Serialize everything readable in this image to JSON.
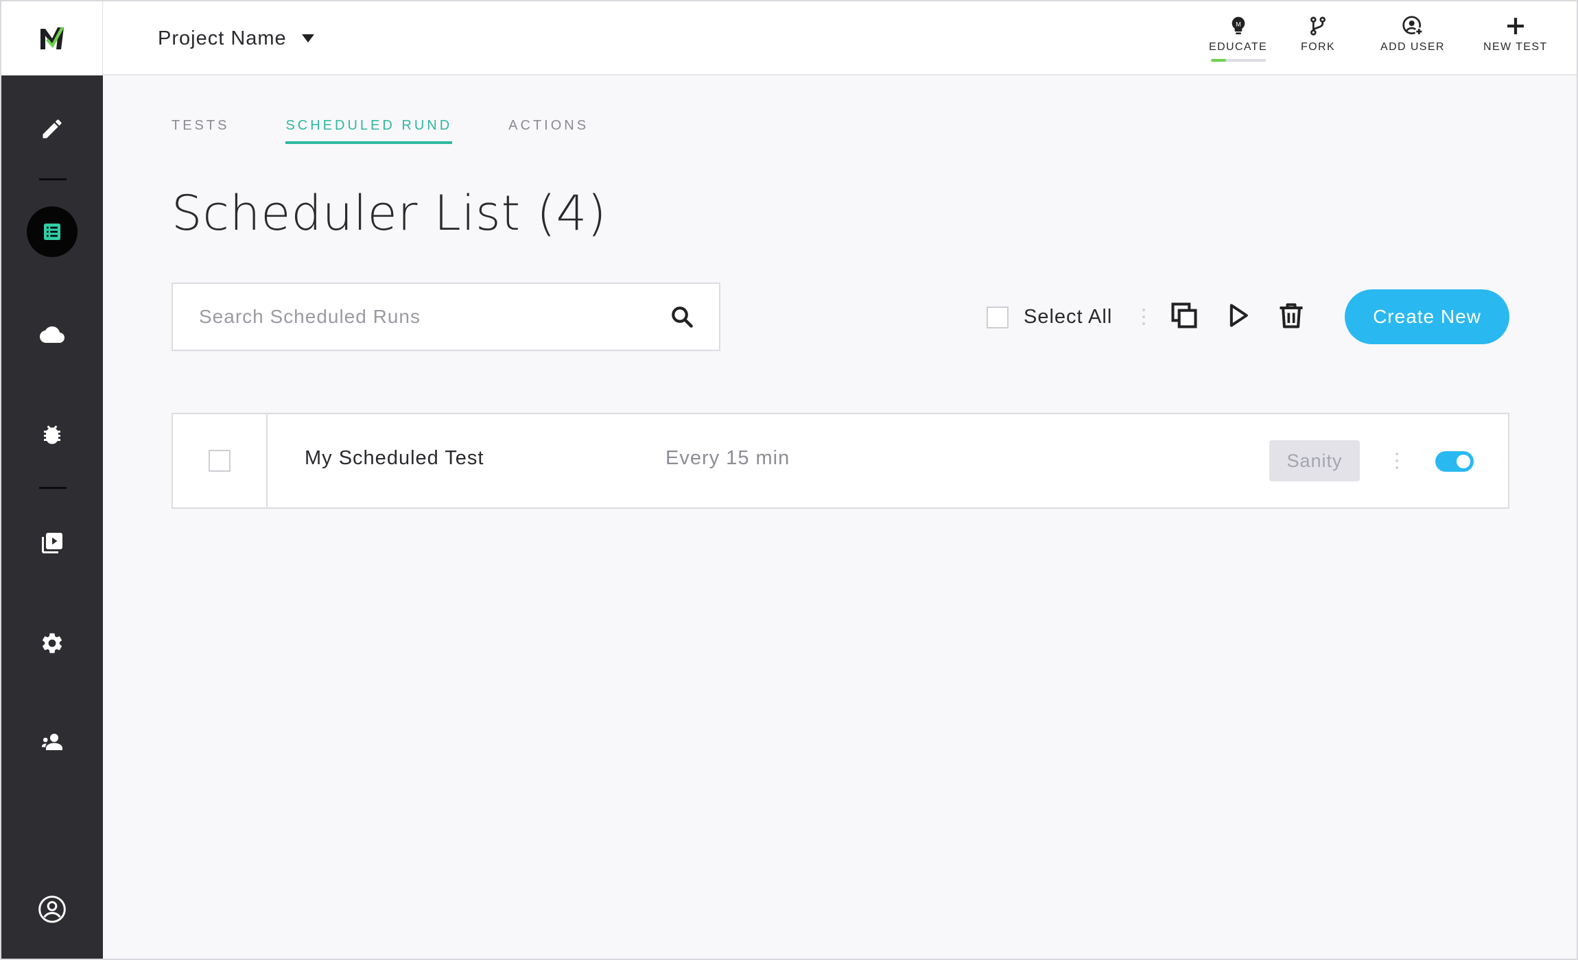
{
  "header": {
    "project_name": "Project Name",
    "actions": [
      {
        "label": "EDUCATE",
        "icon": "lightbulb-icon"
      },
      {
        "label": "FORK",
        "icon": "fork-icon"
      },
      {
        "label": "ADD USER",
        "icon": "add-user-icon"
      },
      {
        "label": "NEW TEST",
        "icon": "plus-icon"
      }
    ]
  },
  "sidebar": {
    "items": [
      {
        "icon": "pencil-icon"
      },
      {
        "icon": "list-icon",
        "active": true
      },
      {
        "icon": "cloud-icon"
      },
      {
        "icon": "bug-icon"
      },
      {
        "icon": "playlist-icon"
      },
      {
        "icon": "gear-icon"
      },
      {
        "icon": "team-icon"
      },
      {
        "icon": "user-account-icon"
      }
    ]
  },
  "tabs": [
    {
      "label": "TESTS",
      "active": false
    },
    {
      "label": "SCHEDULED RUND",
      "active": true
    },
    {
      "label": "ACTIONS",
      "active": false
    }
  ],
  "page": {
    "title": "Scheduler List (4)"
  },
  "search": {
    "placeholder": "Search Scheduled Runs",
    "value": ""
  },
  "toolbar": {
    "select_all_label": "Select All",
    "create_label": "Create New"
  },
  "rows": [
    {
      "name": "My Scheduled Test",
      "frequency": "Every 15 min",
      "tag": "Sanity",
      "enabled": true,
      "checked": false
    }
  ],
  "colors": {
    "accent_teal": "#2fb8a0",
    "primary_blue": "#2ab8f0",
    "sidebar_bg": "#2e2e32",
    "logo_green": "#6fd14f"
  }
}
